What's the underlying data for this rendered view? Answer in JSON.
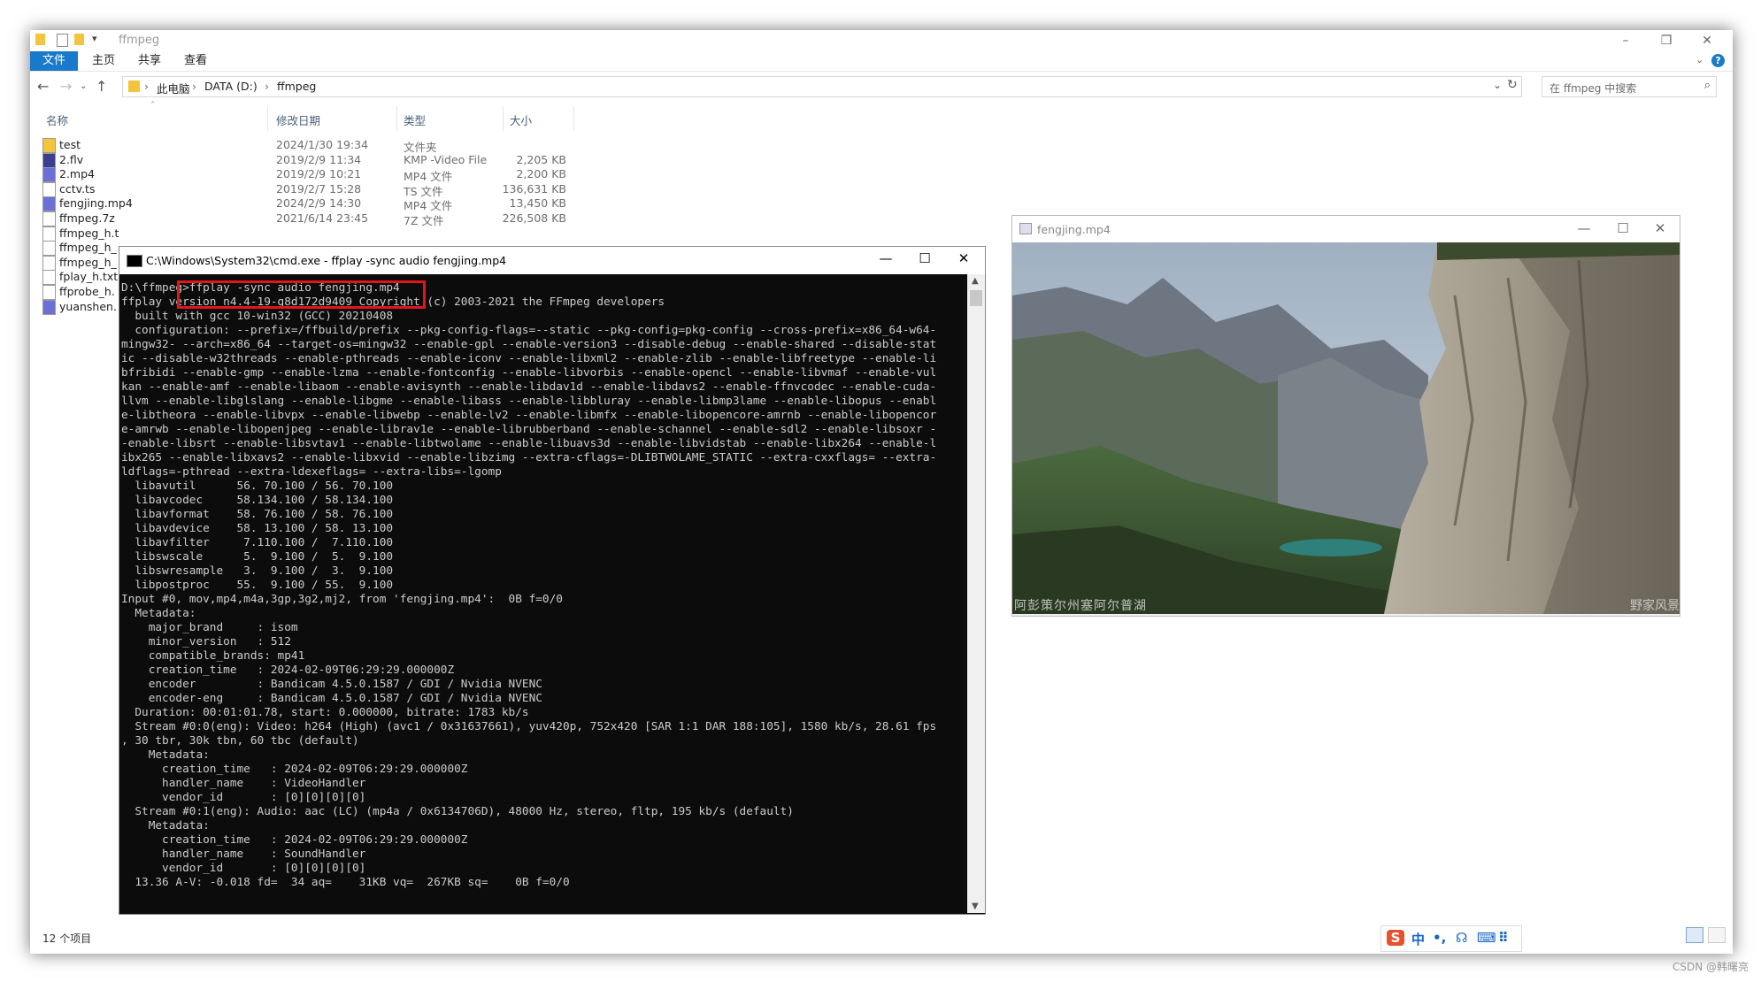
{
  "explorer": {
    "title": "ffmpeg",
    "window_controls": [
      "–",
      "❐",
      "✕"
    ],
    "ribbon_tabs": [
      "文件",
      "主页",
      "共享",
      "查看"
    ],
    "address": {
      "crumbs": [
        "此电脑",
        "DATA (D:)",
        "ffmpeg"
      ],
      "separators": [
        "›",
        "›",
        "›"
      ]
    },
    "search_placeholder": "在 ffmpeg 中搜索",
    "columns": {
      "name": "名称",
      "date": "修改日期",
      "type": "类型",
      "size": "大小"
    },
    "files": [
      {
        "name": "test",
        "date": "2024/1/30 19:34",
        "type": "文件夹",
        "size": "",
        "icon": "folder-icon"
      },
      {
        "name": "2.flv",
        "date": "2019/2/9 11:34",
        "type": "KMP -Video File",
        "size": "2,205 KB",
        "icon": "flv-file-icon"
      },
      {
        "name": "2.mp4",
        "date": "2019/2/9 10:21",
        "type": "MP4 文件",
        "size": "2,200 KB",
        "icon": "mp4-file-icon"
      },
      {
        "name": "cctv.ts",
        "date": "2019/2/7 15:28",
        "type": "TS 文件",
        "size": "136,631 KB",
        "icon": "ts-file-icon"
      },
      {
        "name": "fengjing.mp4",
        "date": "2024/2/9 14:30",
        "type": "MP4 文件",
        "size": "13,450 KB",
        "icon": "mp4-file-icon"
      },
      {
        "name": "ffmpeg.7z",
        "date": "2021/6/14 23:45",
        "type": "7Z 文件",
        "size": "226,508 KB",
        "icon": "archive-file-icon"
      },
      {
        "name": "ffmpeg_h.t",
        "date": "",
        "type": "",
        "size": "",
        "icon": "text-file-icon"
      },
      {
        "name": "ffmpeg_h_",
        "date": "",
        "type": "",
        "size": "",
        "icon": "text-file-icon"
      },
      {
        "name": "ffmpeg_h_",
        "date": "",
        "type": "",
        "size": "",
        "icon": "text-file-icon"
      },
      {
        "name": "fplay_h.txt",
        "date": "",
        "type": "",
        "size": "",
        "icon": "text-file-icon"
      },
      {
        "name": "ffprobe_h.",
        "date": "",
        "type": "",
        "size": "",
        "icon": "text-file-icon"
      },
      {
        "name": "yuanshen.",
        "date": "",
        "type": "",
        "size": "",
        "icon": "mp4-file-icon"
      }
    ],
    "status": "12 个项目"
  },
  "cmd": {
    "title": "C:\\Windows\\System32\\cmd.exe - ffplay  -sync audio fengjing.mp4",
    "window_controls": [
      "—",
      "☐",
      "✕"
    ],
    "scroll_up": "▲",
    "scroll_down": "▼",
    "output": "D:\\ffmpeg>ffplay -sync audio fengjing.mp4\nffplay version n4.4-19-g8d172d9409 Copyright (c) 2003-2021 the FFmpeg developers\n  built with gcc 10-win32 (GCC) 20210408\n  configuration: --prefix=/ffbuild/prefix --pkg-config-flags=--static --pkg-config=pkg-config --cross-prefix=x86_64-w64-\nmingw32- --arch=x86_64 --target-os=mingw32 --enable-gpl --enable-version3 --disable-debug --enable-shared --disable-stat\nic --disable-w32threads --enable-pthreads --enable-iconv --enable-libxml2 --enable-zlib --enable-libfreetype --enable-li\nbfribidi --enable-gmp --enable-lzma --enable-fontconfig --enable-libvorbis --enable-opencl --enable-libvmaf --enable-vul\nkan --enable-amf --enable-libaom --enable-avisynth --enable-libdav1d --enable-libdavs2 --enable-ffnvcodec --enable-cuda-\nllvm --enable-libglslang --enable-libgme --enable-libass --enable-libbluray --enable-libmp3lame --enable-libopus --enabl\ne-libtheora --enable-libvpx --enable-libwebp --enable-lv2 --enable-libmfx --enable-libopencore-amrnb --enable-libopencor\ne-amrwb --enable-libopenjpeg --enable-librav1e --enable-librubberband --enable-schannel --enable-sdl2 --enable-libsoxr -\n-enable-libsrt --enable-libsvtav1 --enable-libtwolame --enable-libuavs3d --enable-libvidstab --enable-libx264 --enable-l\nibx265 --enable-libxavs2 --enable-libxvid --enable-libzimg --extra-cflags=-DLIBTWOLAME_STATIC --extra-cxxflags= --extra-\nldflags=-pthread --extra-ldexeflags= --extra-libs=-lgomp\n  libavutil      56. 70.100 / 56. 70.100\n  libavcodec     58.134.100 / 58.134.100\n  libavformat    58. 76.100 / 58. 76.100\n  libavdevice    58. 13.100 / 58. 13.100\n  libavfilter     7.110.100 /  7.110.100\n  libswscale      5.  9.100 /  5.  9.100\n  libswresample   3.  9.100 /  3.  9.100\n  libpostproc    55.  9.100 / 55.  9.100\nInput #0, mov,mp4,m4a,3gp,3g2,mj2, from 'fengjing.mp4':  0B f=0/0\n  Metadata:\n    major_brand     : isom\n    minor_version   : 512\n    compatible_brands: mp41\n    creation_time   : 2024-02-09T06:29:29.000000Z\n    encoder         : Bandicam 4.5.0.1587 / GDI / Nvidia NVENC\n    encoder-eng     : Bandicam 4.5.0.1587 / GDI / Nvidia NVENC\n  Duration: 00:01:01.78, start: 0.000000, bitrate: 1783 kb/s\n  Stream #0:0(eng): Video: h264 (High) (avc1 / 0x31637661), yuv420p, 752x420 [SAR 1:1 DAR 188:105], 1580 kb/s, 28.61 fps\n, 30 tbr, 30k tbn, 60 tbc (default)\n    Metadata:\n      creation_time   : 2024-02-09T06:29:29.000000Z\n      handler_name    : VideoHandler\n      vendor_id       : [0][0][0][0]\n  Stream #0:1(eng): Audio: aac (LC) (mp4a / 0x6134706D), 48000 Hz, stereo, fltp, 195 kb/s (default)\n    Metadata:\n      creation_time   : 2024-02-09T06:29:29.000000Z\n      handler_name    : SoundHandler\n      vendor_id       : [0][0][0][0]\n  13.36 A-V: -0.018 fd=  34 aq=    31KB vq=  267KB sq=    0B f=0/0"
  },
  "player": {
    "title": "fengjing.mp4",
    "window_controls": [
      "—",
      "☐",
      "✕"
    ],
    "subtitle_left": "阿彭策尔州塞阿尔普湖",
    "subtitle_right": "野家风景"
  },
  "ime": {
    "glyphs": [
      "S",
      "中",
      "•,",
      "☊",
      "⌨",
      "⠿"
    ]
  },
  "watermark": "CSDN @韩曙亮",
  "colors": {
    "accent": "#1979ca",
    "highlight": "#e4141b",
    "terminal_bg": "#0c0c0c",
    "terminal_fg": "#cccccc"
  }
}
